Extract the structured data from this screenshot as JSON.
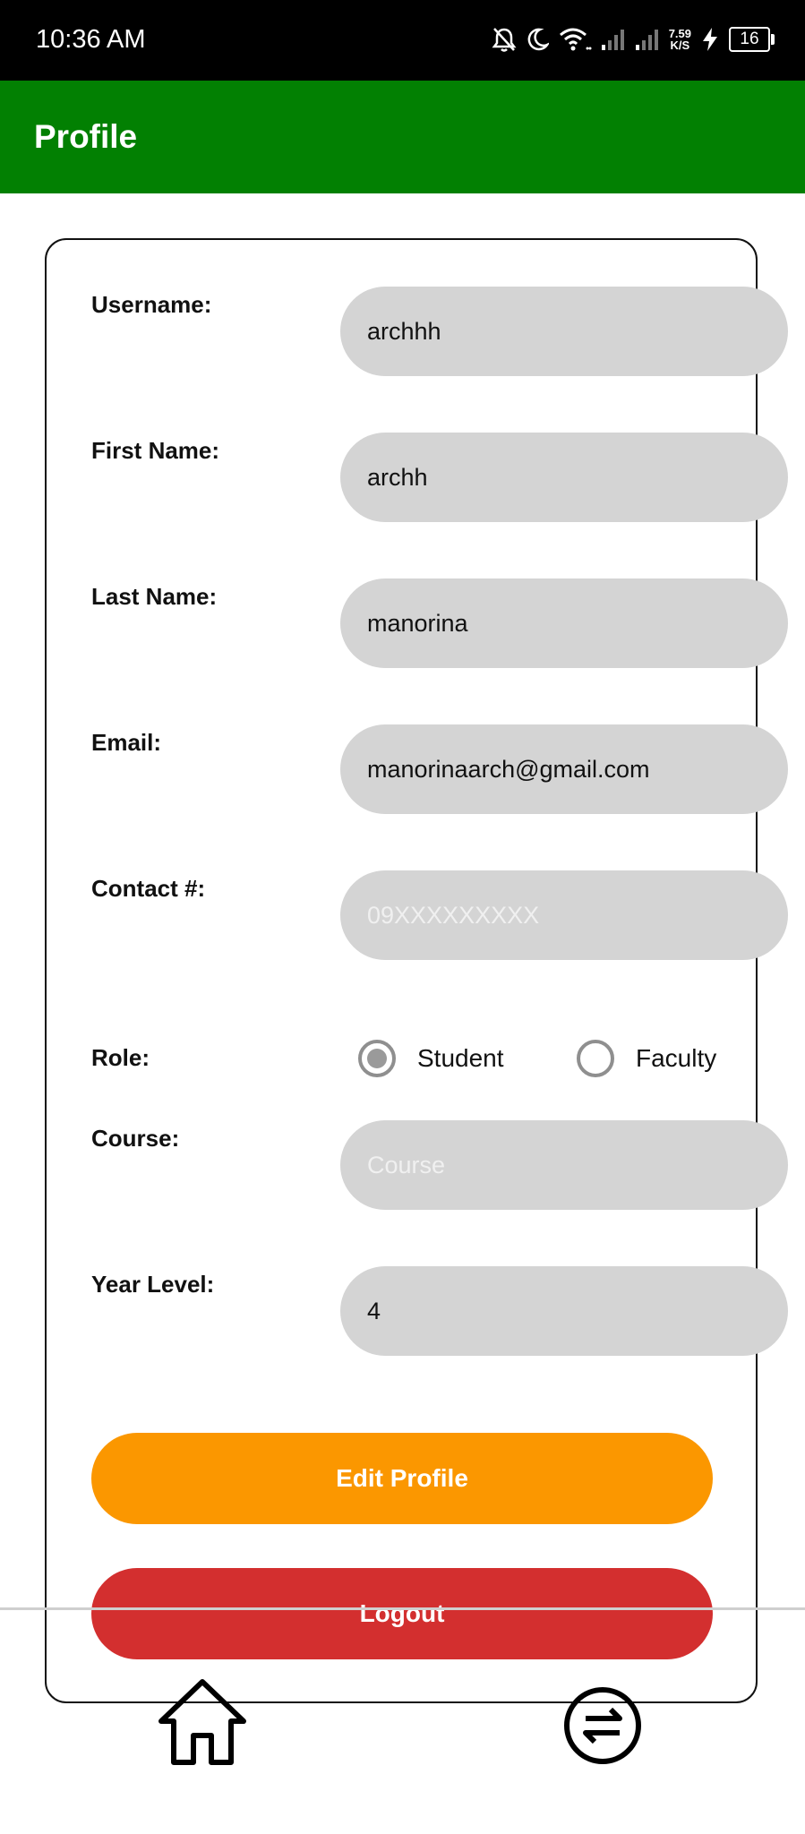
{
  "status_bar": {
    "time": "10:36 AM",
    "net_speed_value": "7.59",
    "net_speed_unit": "K/S",
    "battery": "16",
    "icons": [
      "bell-off-icon",
      "moon-icon",
      "wifi-icon",
      "signal-icon",
      "signal-icon",
      "charging-icon",
      "battery-icon"
    ]
  },
  "app_bar": {
    "title": "Profile"
  },
  "form": {
    "username": {
      "label": "Username:",
      "value": "archhh"
    },
    "first_name": {
      "label": "First Name:",
      "value": "archh"
    },
    "last_name": {
      "label": "Last Name:",
      "value": "manorina"
    },
    "email": {
      "label": "Email:",
      "value": "manorinaarch@gmail.com"
    },
    "contact": {
      "label": "Contact #:",
      "value": "",
      "placeholder": "09XXXXXXXXX"
    },
    "role": {
      "label": "Role:",
      "options": [
        "Student",
        "Faculty"
      ],
      "selected": "Student"
    },
    "course": {
      "label": "Course:",
      "value": "",
      "placeholder": "Course"
    },
    "year_level": {
      "label": "Year Level:",
      "value": "4"
    }
  },
  "buttons": {
    "edit_profile": "Edit Profile",
    "logout": "Logout"
  },
  "bottom_nav": {
    "items": [
      "home-icon",
      "exchange-icon"
    ]
  },
  "colors": {
    "app_bar": "#028002",
    "edit_button": "#fb9700",
    "logout_button": "#d32f2f",
    "input_bg": "#d4d4d4"
  }
}
